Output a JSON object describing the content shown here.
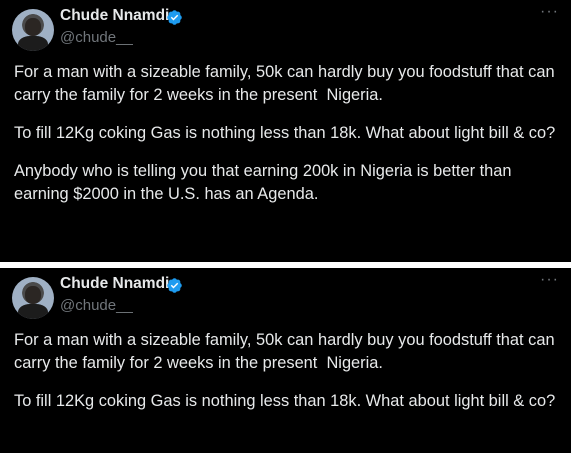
{
  "tweets": [
    {
      "author": {
        "display_name": "Chude Nnamdi",
        "handle": "@chude__",
        "verified": true
      },
      "more_label": "···",
      "paragraphs": [
        "For a man with a sizeable family, 50k can hardly buy you foodstuff that can carry the family for 2 weeks in the present  Nigeria.",
        "To fill 12Kg coking Gas is nothing less than 18k. What about light bill & co?",
        "Anybody who is telling you that earning 200k in Nigeria is better than earning $2000 in the U.S. has an Agenda."
      ]
    },
    {
      "author": {
        "display_name": "Chude Nnamdi",
        "handle": "@chude__",
        "verified": true
      },
      "more_label": "···",
      "paragraphs": [
        "For a man with a sizeable family, 50k can hardly buy you foodstuff that can carry the family for 2 weeks in the present  Nigeria.",
        "To fill 12Kg coking Gas is nothing less than 18k. What about light bill & co?"
      ]
    }
  ],
  "colors": {
    "background": "#000000",
    "text": "#e7e9ea",
    "secondary": "#71767b",
    "verified_badge": "#1d9bf0",
    "divider": "#ffffff"
  },
  "icons": [
    "verified-badge-icon",
    "more-options-icon"
  ]
}
